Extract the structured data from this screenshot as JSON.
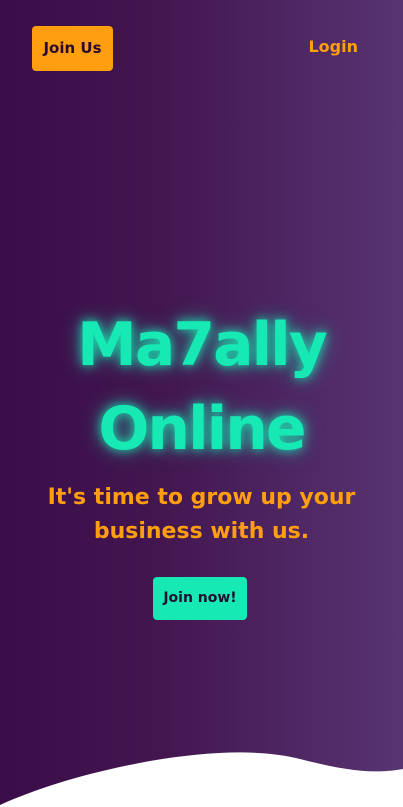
{
  "nav": {
    "join_label": "Join Us",
    "login_label": "Login"
  },
  "hero": {
    "title_line1": "Ma7ally",
    "title_line2": "Online",
    "subtitle": "It's time to grow up your business with us.",
    "cta_label": "Join now!"
  },
  "colors": {
    "accent_orange": "#ff9e0f",
    "accent_green": "#17e9b4",
    "background_dark": "#3a0d4a",
    "background_light": "#573472",
    "wave": "#ffffff"
  }
}
